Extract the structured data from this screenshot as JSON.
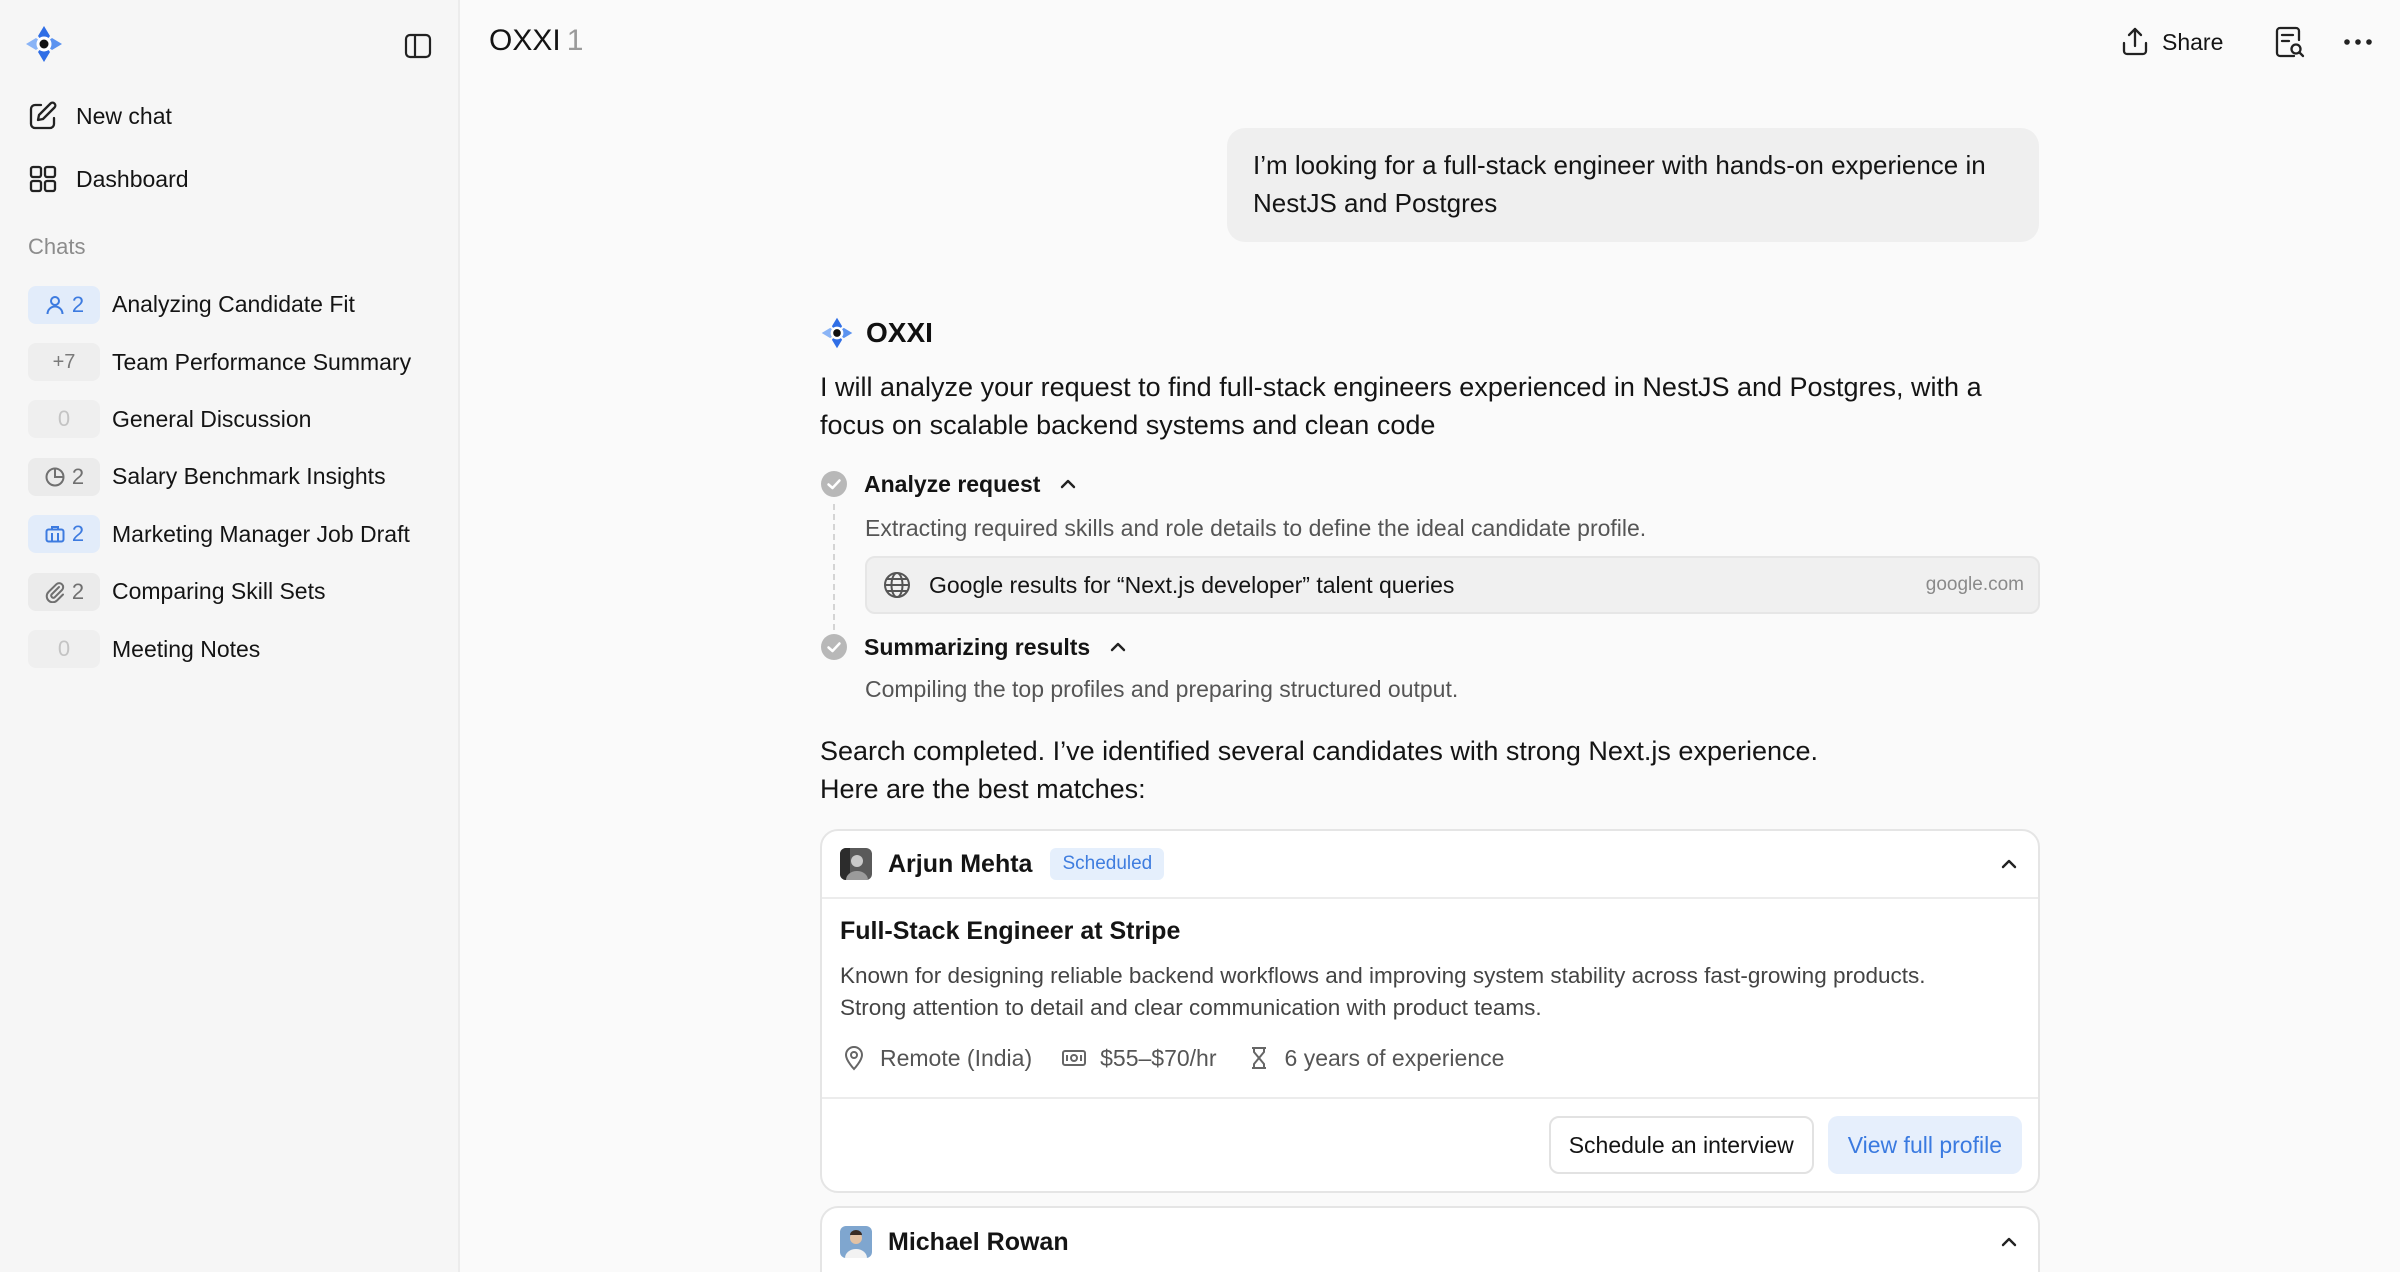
{
  "sidebar": {
    "new_chat": "New chat",
    "dashboard": "Dashboard",
    "chats_heading": "Chats",
    "chats": [
      {
        "badge": "2",
        "badge_icon": "user-icon",
        "style": "blue",
        "label": "Analyzing Candidate Fit"
      },
      {
        "badge": "+7",
        "badge_icon": "",
        "style": "plus",
        "label": "Team Performance Summary"
      },
      {
        "badge": "0",
        "badge_icon": "",
        "style": "empty",
        "label": "General Discussion"
      },
      {
        "badge": "2",
        "badge_icon": "pie-chart-icon",
        "style": "gray",
        "label": "Salary Benchmark Insights"
      },
      {
        "badge": "2",
        "badge_icon": "briefcase-icon",
        "style": "blue",
        "label": "Marketing Manager Job Draft"
      },
      {
        "badge": "2",
        "badge_icon": "paperclip-icon",
        "style": "gray",
        "label": "Comparing Skill Sets"
      },
      {
        "badge": "0",
        "badge_icon": "",
        "style": "empty",
        "label": "Meeting Notes"
      }
    ]
  },
  "header": {
    "title": "OXXI",
    "title_count": "1",
    "share_label": "Share"
  },
  "conversation": {
    "user_message": "I’m looking for a full-stack engineer with hands-on experience in NestJS and Postgres",
    "assistant_name": "OXXI",
    "intro": "I will analyze your request to find full-stack engineers experienced in NestJS and Postgres, with a focus on scalable backend systems and clean code",
    "steps": [
      {
        "title": "Analyze request",
        "description": "Extracting required skills and role details to define the ideal candidate profile."
      },
      {
        "title": "Summarizing results",
        "description": "Compiling the top profiles and preparing structured output."
      }
    ],
    "source": {
      "text": "Google results for “Next.js developer” talent queries",
      "domain": "google.com"
    },
    "result_line1": "Search completed. I’ve identified several candidates with strong Next.js experience.",
    "result_line2": "Here are the best matches:"
  },
  "candidates": [
    {
      "name": "Arjun Mehta",
      "status": "Scheduled",
      "role": "Full-Stack Engineer at Stripe",
      "description_line1": "Known for designing reliable backend workflows and improving system stability across fast-growing products.",
      "description_line2": "Strong attention to detail and clear communication with product teams.",
      "location": "Remote (India)",
      "rate": "$55–$70/hr",
      "experience": "6 years of experience",
      "schedule_label": "Schedule an interview",
      "profile_label": "View full profile"
    },
    {
      "name": "Michael Rowan"
    }
  ],
  "colors": {
    "accent": "#3d7be0",
    "accent_soft": "#e5effc",
    "sidebar_bg": "#f6f6f6",
    "page_bg": "#fafafa"
  }
}
